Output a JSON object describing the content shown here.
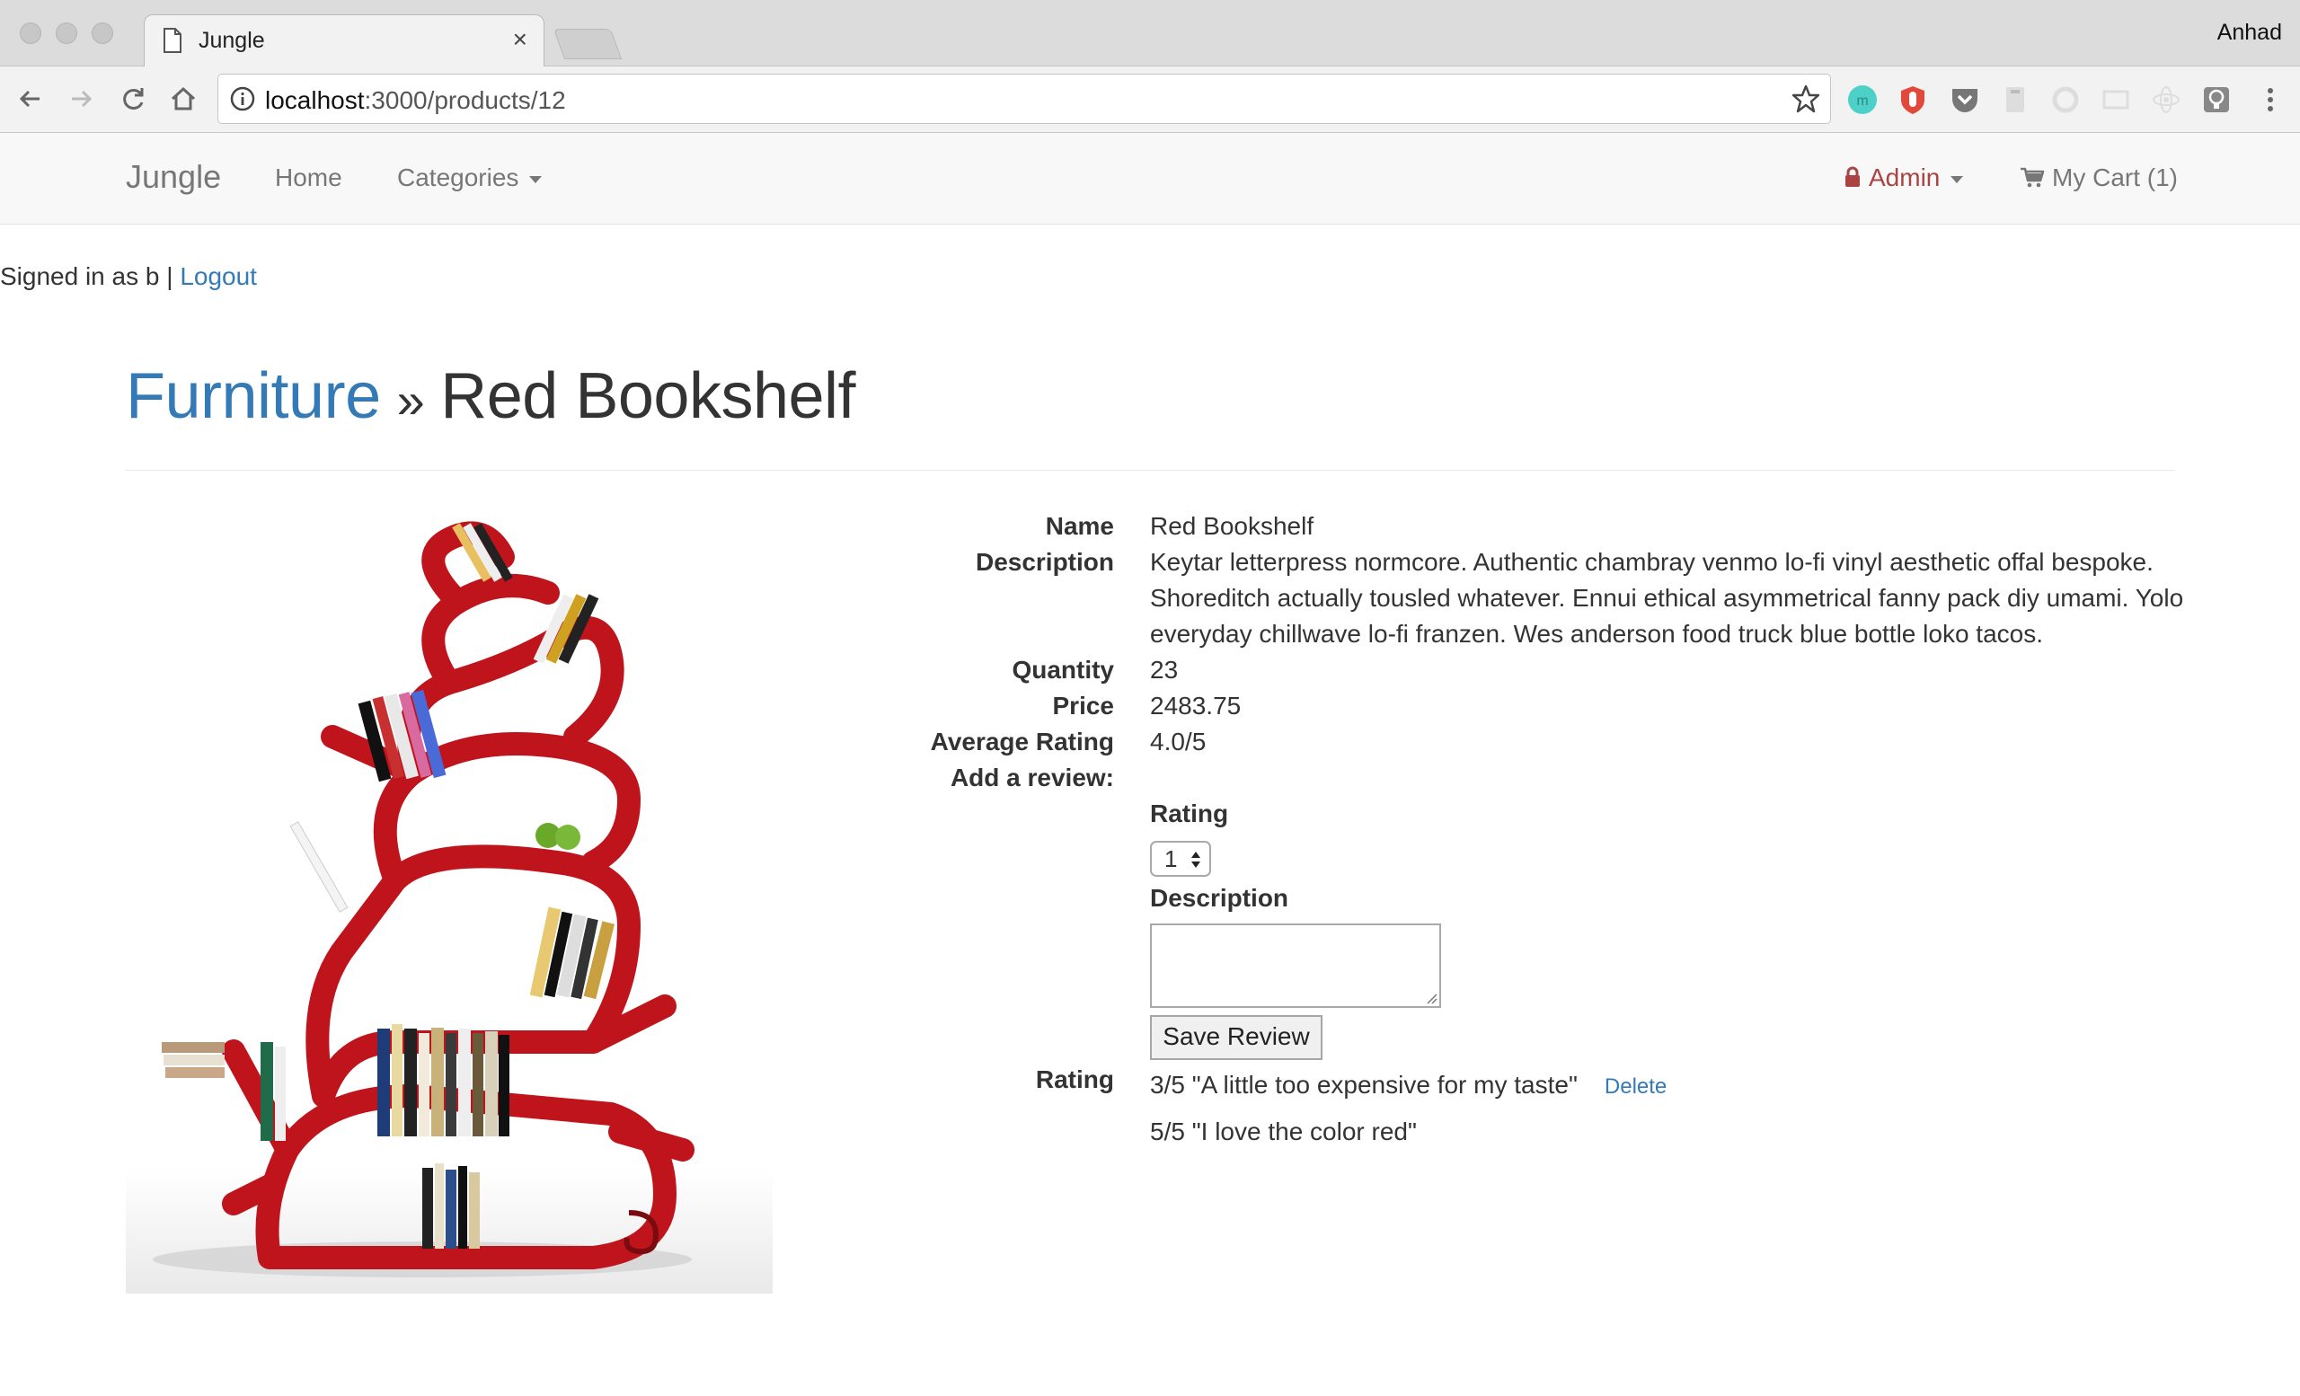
{
  "browser": {
    "tab_title": "Jungle",
    "tab_close": "×",
    "profile_name": "Anhad",
    "url_host": "localhost",
    "url_rest": ":3000/products/12"
  },
  "nav": {
    "brand": "Jungle",
    "home": "Home",
    "categories": "Categories",
    "admin": "Admin",
    "cart": "My Cart (1)",
    "admin_color": "#a94442",
    "link_color": "#777777"
  },
  "session": {
    "signed_in_text": "Signed in as b",
    "separator": "|",
    "logout": "Logout"
  },
  "page": {
    "category": "Furniture",
    "title_separator": "»",
    "product_name": "Red Bookshelf",
    "link_color": "#337ab7"
  },
  "product": {
    "name_label": "Name",
    "name": "Red Bookshelf",
    "description_label": "Description",
    "description": "Keytar letterpress normcore. Authentic chambray venmo lo-fi vinyl aesthetic offal bespoke. Shoreditch actually tousled whatever. Ennui ethical asymmetrical fanny pack diy umami. Yolo everyday chillwave lo-fi franzen. Wes anderson food truck blue bottle loko tacos.",
    "quantity_label": "Quantity",
    "quantity": "23",
    "price_label": "Price",
    "price": "2483.75",
    "avg_rating_label": "Average Rating",
    "avg_rating": "4.0/5",
    "add_review_label": "Add a review:"
  },
  "review_form": {
    "rating_label": "Rating",
    "rating_value": "1",
    "description_label": "Description",
    "description_value": "",
    "save_button": "Save Review"
  },
  "reviews": {
    "label": "Rating",
    "items": [
      {
        "text": "3/5 \"A little too expensive for my taste\"",
        "action": "Delete"
      },
      {
        "text": "5/5 \"I love the color red\""
      }
    ]
  }
}
